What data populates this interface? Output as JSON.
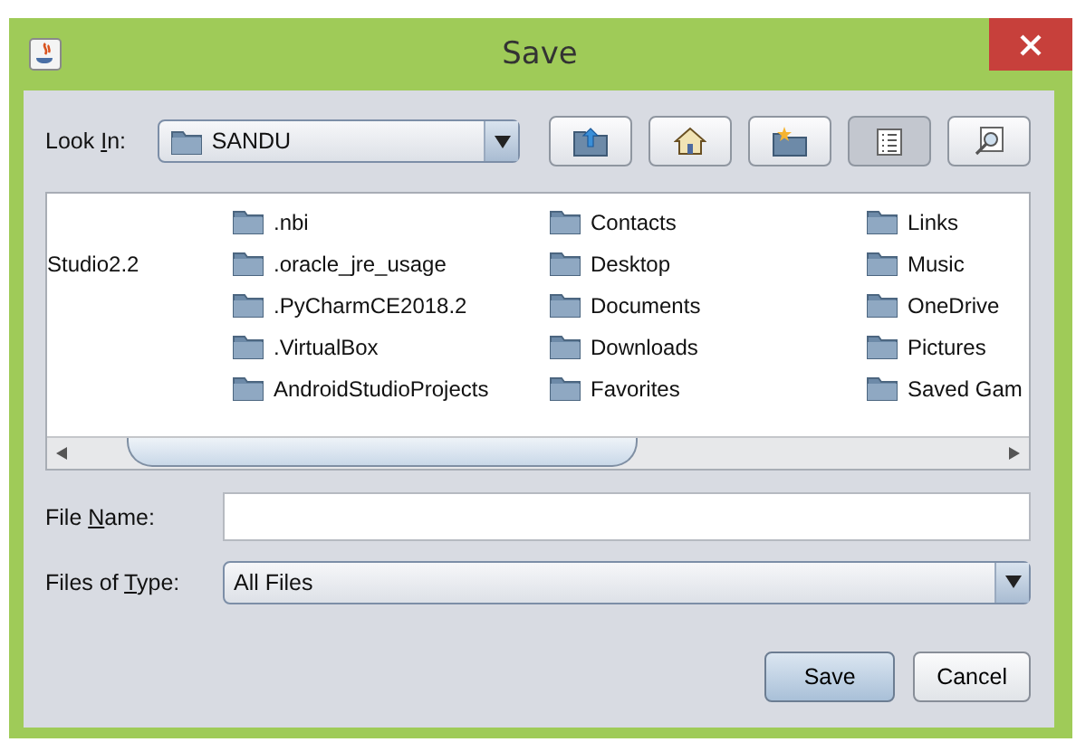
{
  "window": {
    "title": "Save"
  },
  "look_in": {
    "label": {
      "before": "Look ",
      "key": "I",
      "after": "n:"
    },
    "value": "SANDU"
  },
  "toolbar": [
    {
      "kind": "up",
      "selected": false
    },
    {
      "kind": "home",
      "selected": false
    },
    {
      "kind": "new_folder",
      "selected": false
    },
    {
      "kind": "list",
      "selected": true
    },
    {
      "kind": "details",
      "selected": false
    }
  ],
  "file_columns": [
    {
      "kind": "clipped",
      "items": [
        "Studio2.2"
      ]
    },
    {
      "kind": "folders",
      "items": [
        ".nbi",
        ".oracle_jre_usage",
        ".PyCharmCE2018.2",
        ".VirtualBox",
        "AndroidStudioProjects"
      ]
    },
    {
      "kind": "folders",
      "items": [
        "Contacts",
        "Desktop",
        "Documents",
        "Downloads",
        "Favorites"
      ]
    },
    {
      "kind": "folders",
      "items": [
        "Links",
        "Music",
        "OneDrive",
        "Pictures",
        "Saved Gam"
      ]
    }
  ],
  "file_name": {
    "label": {
      "before": "File ",
      "key": "N",
      "after": "ame:"
    }
  },
  "file_type": {
    "label": {
      "before": "Files of ",
      "key": "T",
      "after": "ype:"
    },
    "value": "All Files"
  },
  "buttons": [
    {
      "label": "Save",
      "kind": "default"
    },
    {
      "label": "Cancel",
      "kind": "normal"
    }
  ]
}
